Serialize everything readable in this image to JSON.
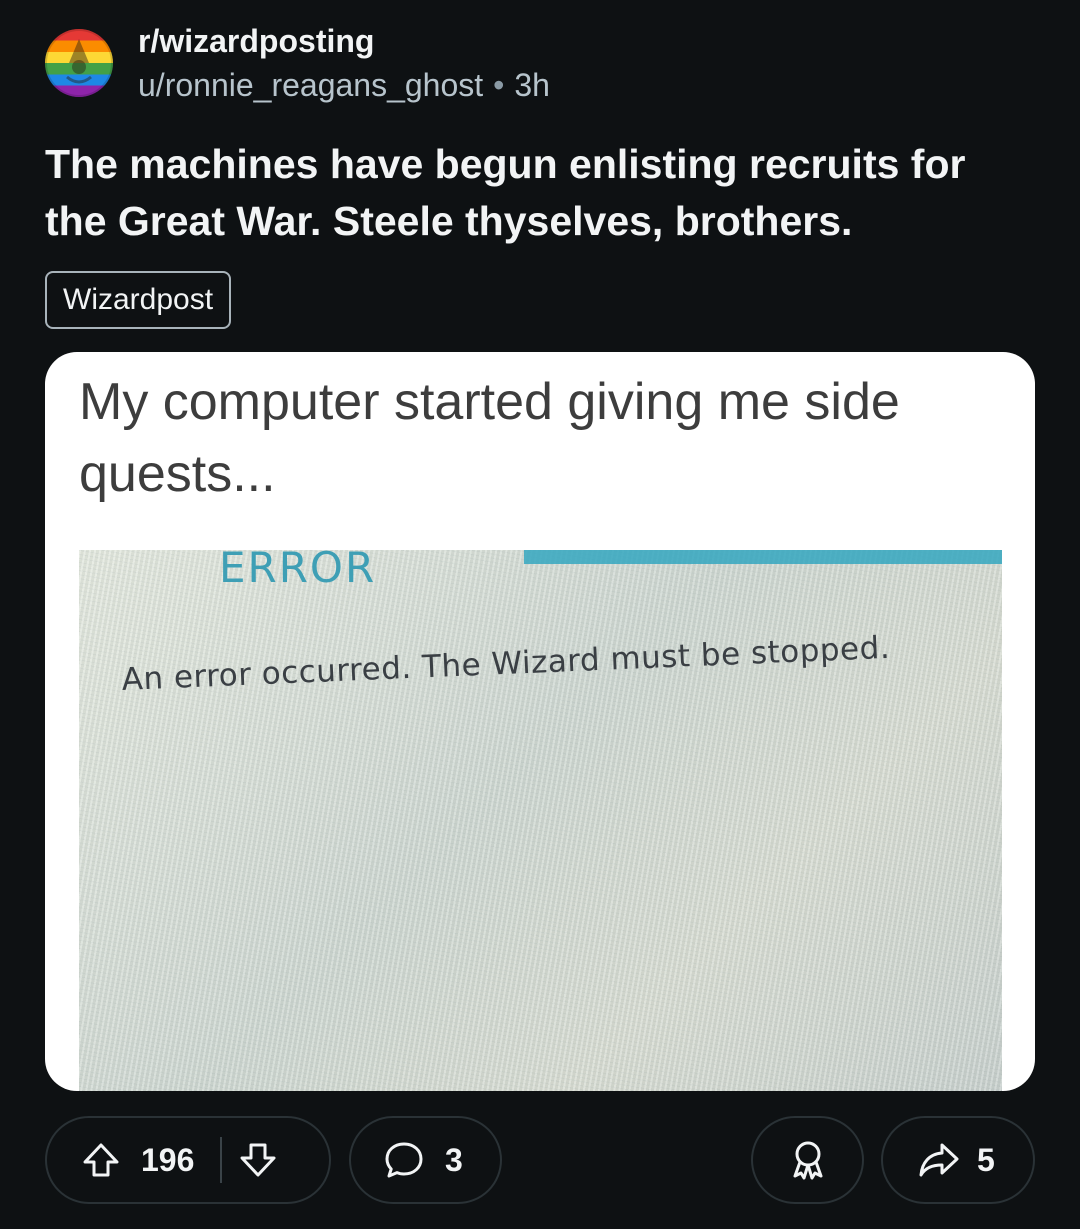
{
  "post": {
    "subreddit": "r/wizardposting",
    "username": "u/ronnie_reagans_ghost",
    "separator": "•",
    "time_ago": "3h",
    "title": "The machines have begun enlisting recruits for the Great War. Steele thyselves, brothers.",
    "flair": "Wizardpost"
  },
  "media": {
    "caption": "My computer started giving me side quests...",
    "photo": {
      "error_title": "ERROR",
      "error_message": "An error occurred. The Wizard must be stopped."
    }
  },
  "actions": {
    "upvotes": "196",
    "comments": "3",
    "shares": "5",
    "icons": [
      "upvote-icon",
      "downvote-icon",
      "comment-icon",
      "award-icon",
      "share-icon"
    ]
  },
  "colors": {
    "background": "#0e1113",
    "text": "#f2f4f5",
    "muted": "#b7c4cc",
    "pill_border": "#2a3236",
    "error_accent": "#3e9fb5"
  }
}
